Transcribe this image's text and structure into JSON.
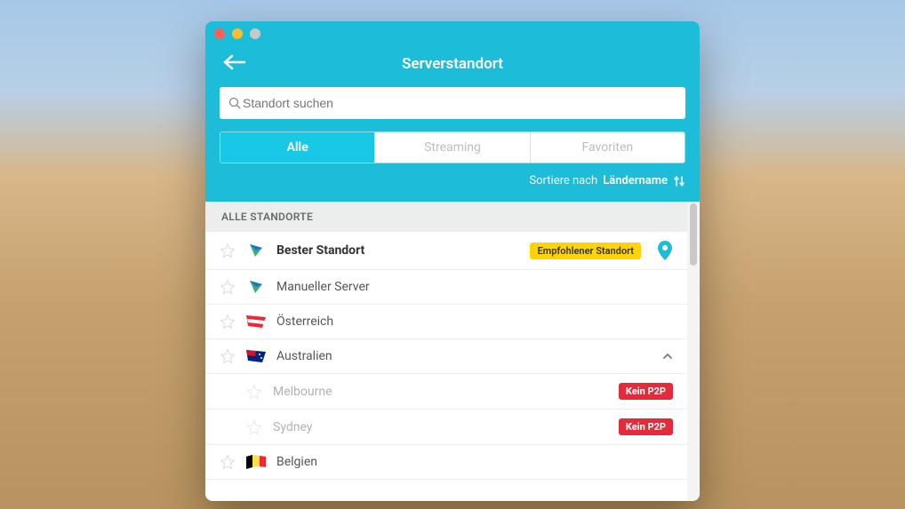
{
  "window": {
    "title": "Serverstandort"
  },
  "search": {
    "placeholder": "Standort suchen"
  },
  "tabs": {
    "all": "Alle",
    "streaming": "Streaming",
    "favorites": "Favoriten"
  },
  "sort": {
    "label": "Sortiere nach",
    "value": "Ländername"
  },
  "section_header": "ALLE STANDORTE",
  "rows": {
    "best": "Bester Standort",
    "best_badge": "Empfohlener Standort",
    "manual": "Manueller Server",
    "austria": "Österreich",
    "australia": "Australien",
    "melbourne": "Melbourne",
    "sydney": "Sydney",
    "belgium": "Belgien",
    "no_p2p": "Kein P2P"
  }
}
